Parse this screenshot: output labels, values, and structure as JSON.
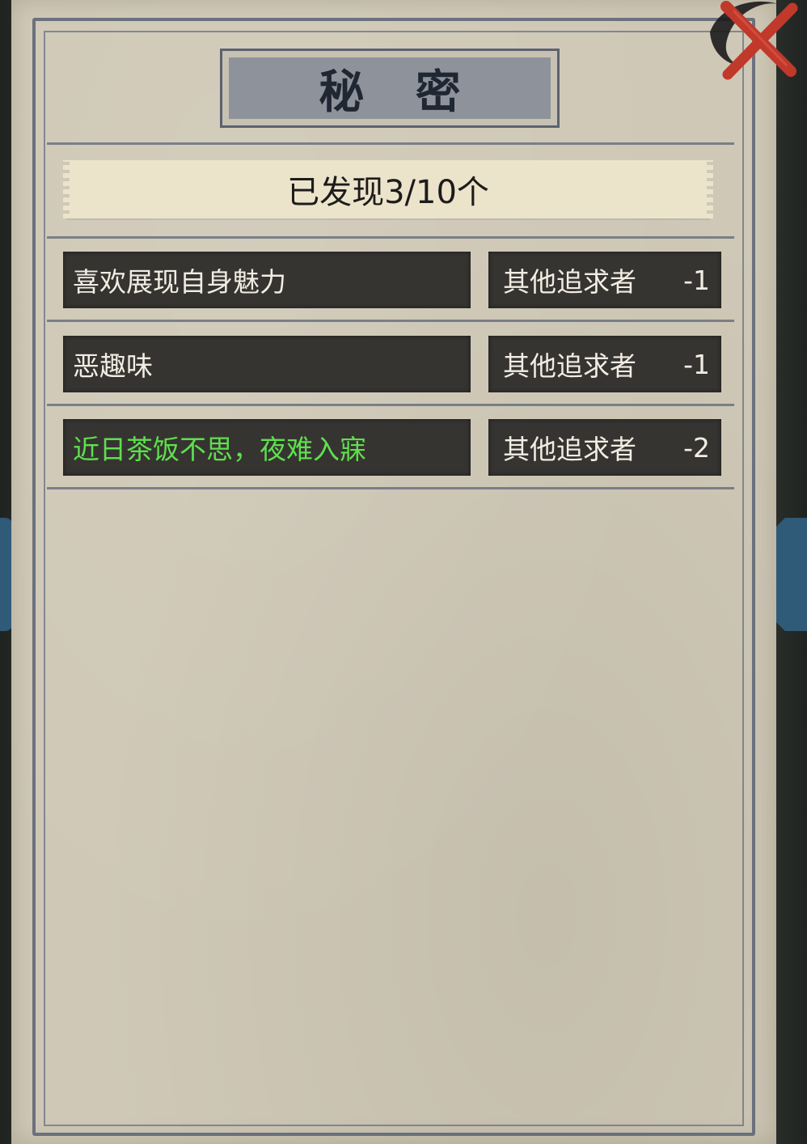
{
  "panel": {
    "title": "秘 密"
  },
  "discovered": {
    "label": "已发现3/10个"
  },
  "secrets": [
    {
      "text": "喜欢展现自身魅力",
      "effect_name": "其他追求者",
      "effect_value": "-1",
      "highlight": false
    },
    {
      "text": "恶趣味",
      "effect_name": "其他追求者",
      "effect_value": "-1",
      "highlight": false
    },
    {
      "text": "近日茶饭不思，夜难入寐",
      "effect_name": "其他追求者",
      "effect_value": "-2",
      "highlight": true
    }
  ],
  "colors": {
    "paper": "#cfc8b6",
    "row_background": "#363431",
    "highlight_text": "#5fdf4e",
    "close_red": "#c0392b"
  },
  "icons": {
    "close": "close-x-icon"
  }
}
